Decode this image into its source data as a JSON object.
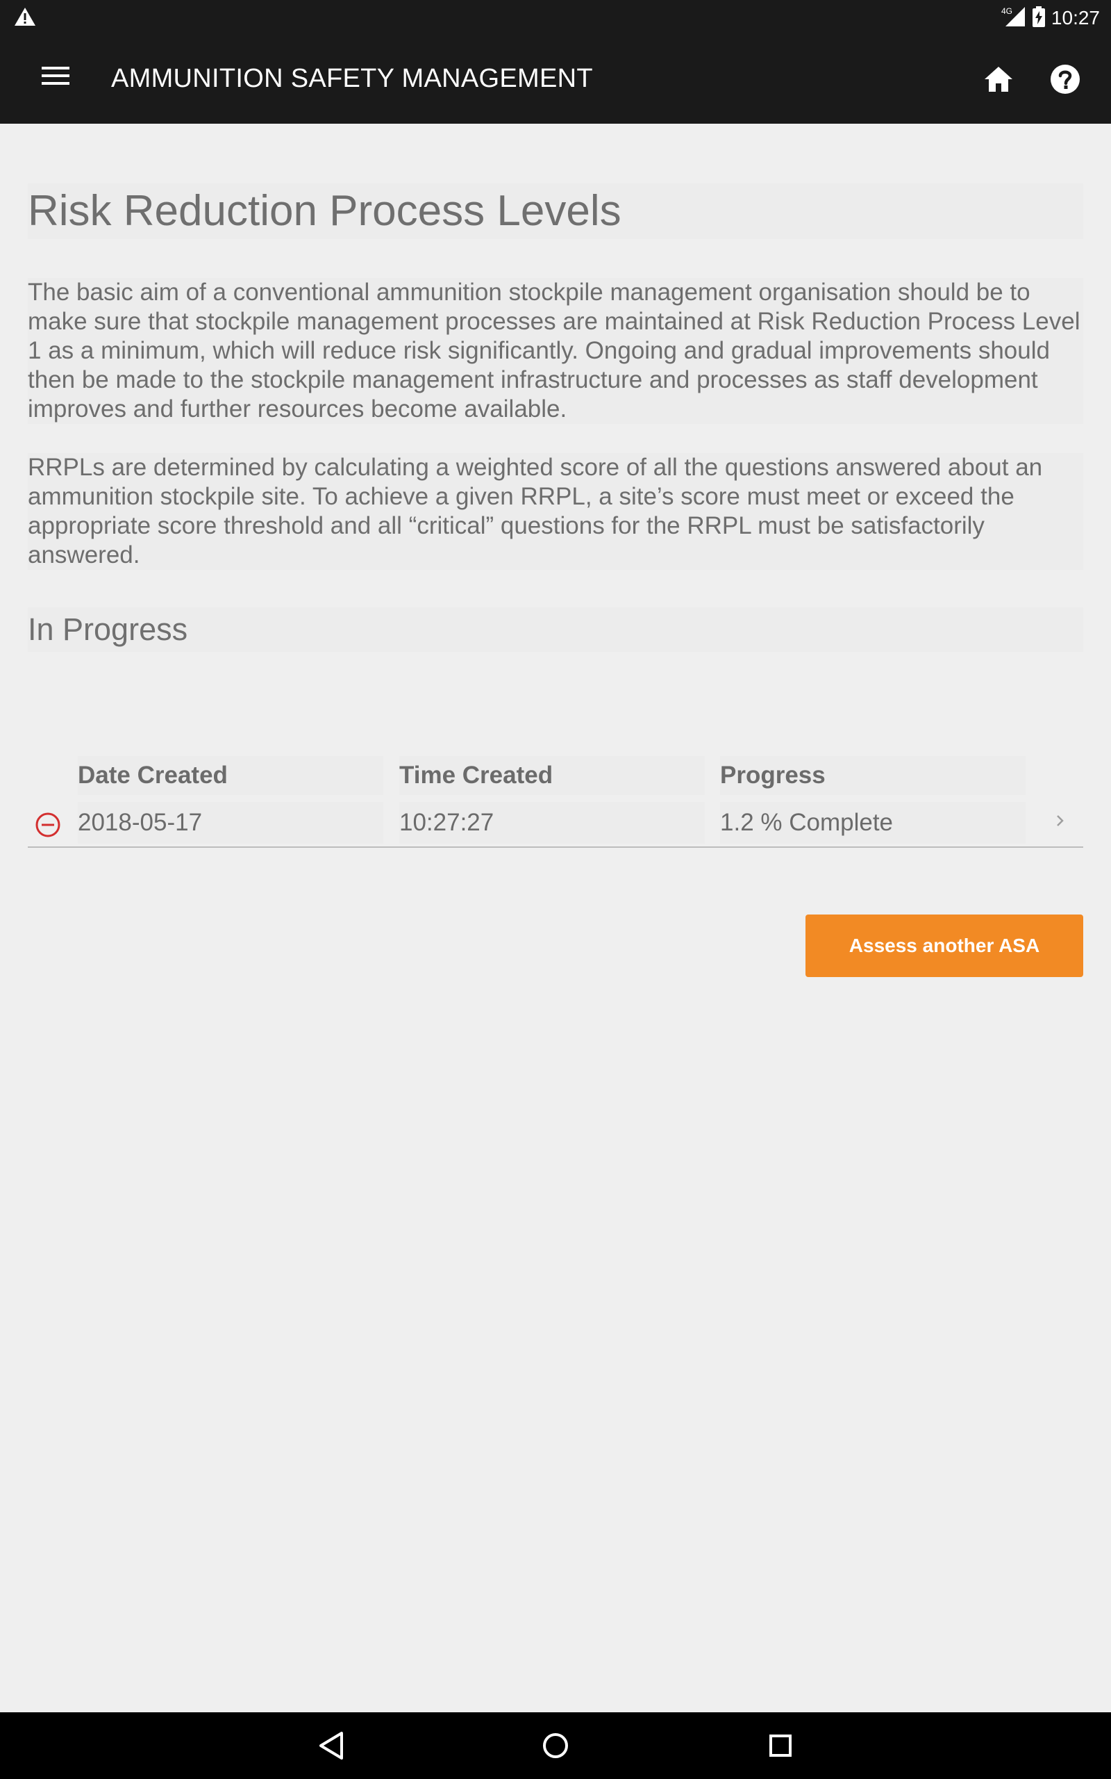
{
  "status_bar": {
    "time": "10:27",
    "network": "4G",
    "icons": [
      "warning-icon",
      "signal-icon",
      "battery-charging-icon"
    ]
  },
  "app_bar": {
    "title": "AMMUNITION SAFETY MANAGEMENT",
    "icons": [
      "menu-icon",
      "home-icon",
      "help-icon"
    ]
  },
  "page": {
    "title": "Risk Reduction Process Levels",
    "paragraph1": "The basic aim of a conventional ammunition stockpile management organisation should be to make sure that stockpile management processes are maintained at Risk Reduction Process Level 1 as a minimum, which will reduce risk significantly. Ongoing and gradual improvements should then be made to the stockpile management infrastructure and processes as staff development improves and further resources become available.",
    "paragraph2": "RRPLs are determined by calculating a weighted score of all the questions answered about an ammunition stockpile site. To achieve a given RRPL, a site’s score must meet or exceed the appropriate score threshold and all “critical” questions for the RRPL must be satisfactorily answered.",
    "section_title": "In Progress"
  },
  "table": {
    "headers": [
      "Date Created",
      "Time Created",
      "Progress"
    ],
    "rows": [
      {
        "date": "2018-05-17",
        "time": "10:27:27",
        "progress": "1.2 % Complete"
      }
    ]
  },
  "actions": {
    "assess_label": "Assess another ASA"
  },
  "colors": {
    "accent": "#f28a24",
    "bar": "#1a1a1a",
    "remove": "#d32f2f",
    "background": "#efefef"
  }
}
